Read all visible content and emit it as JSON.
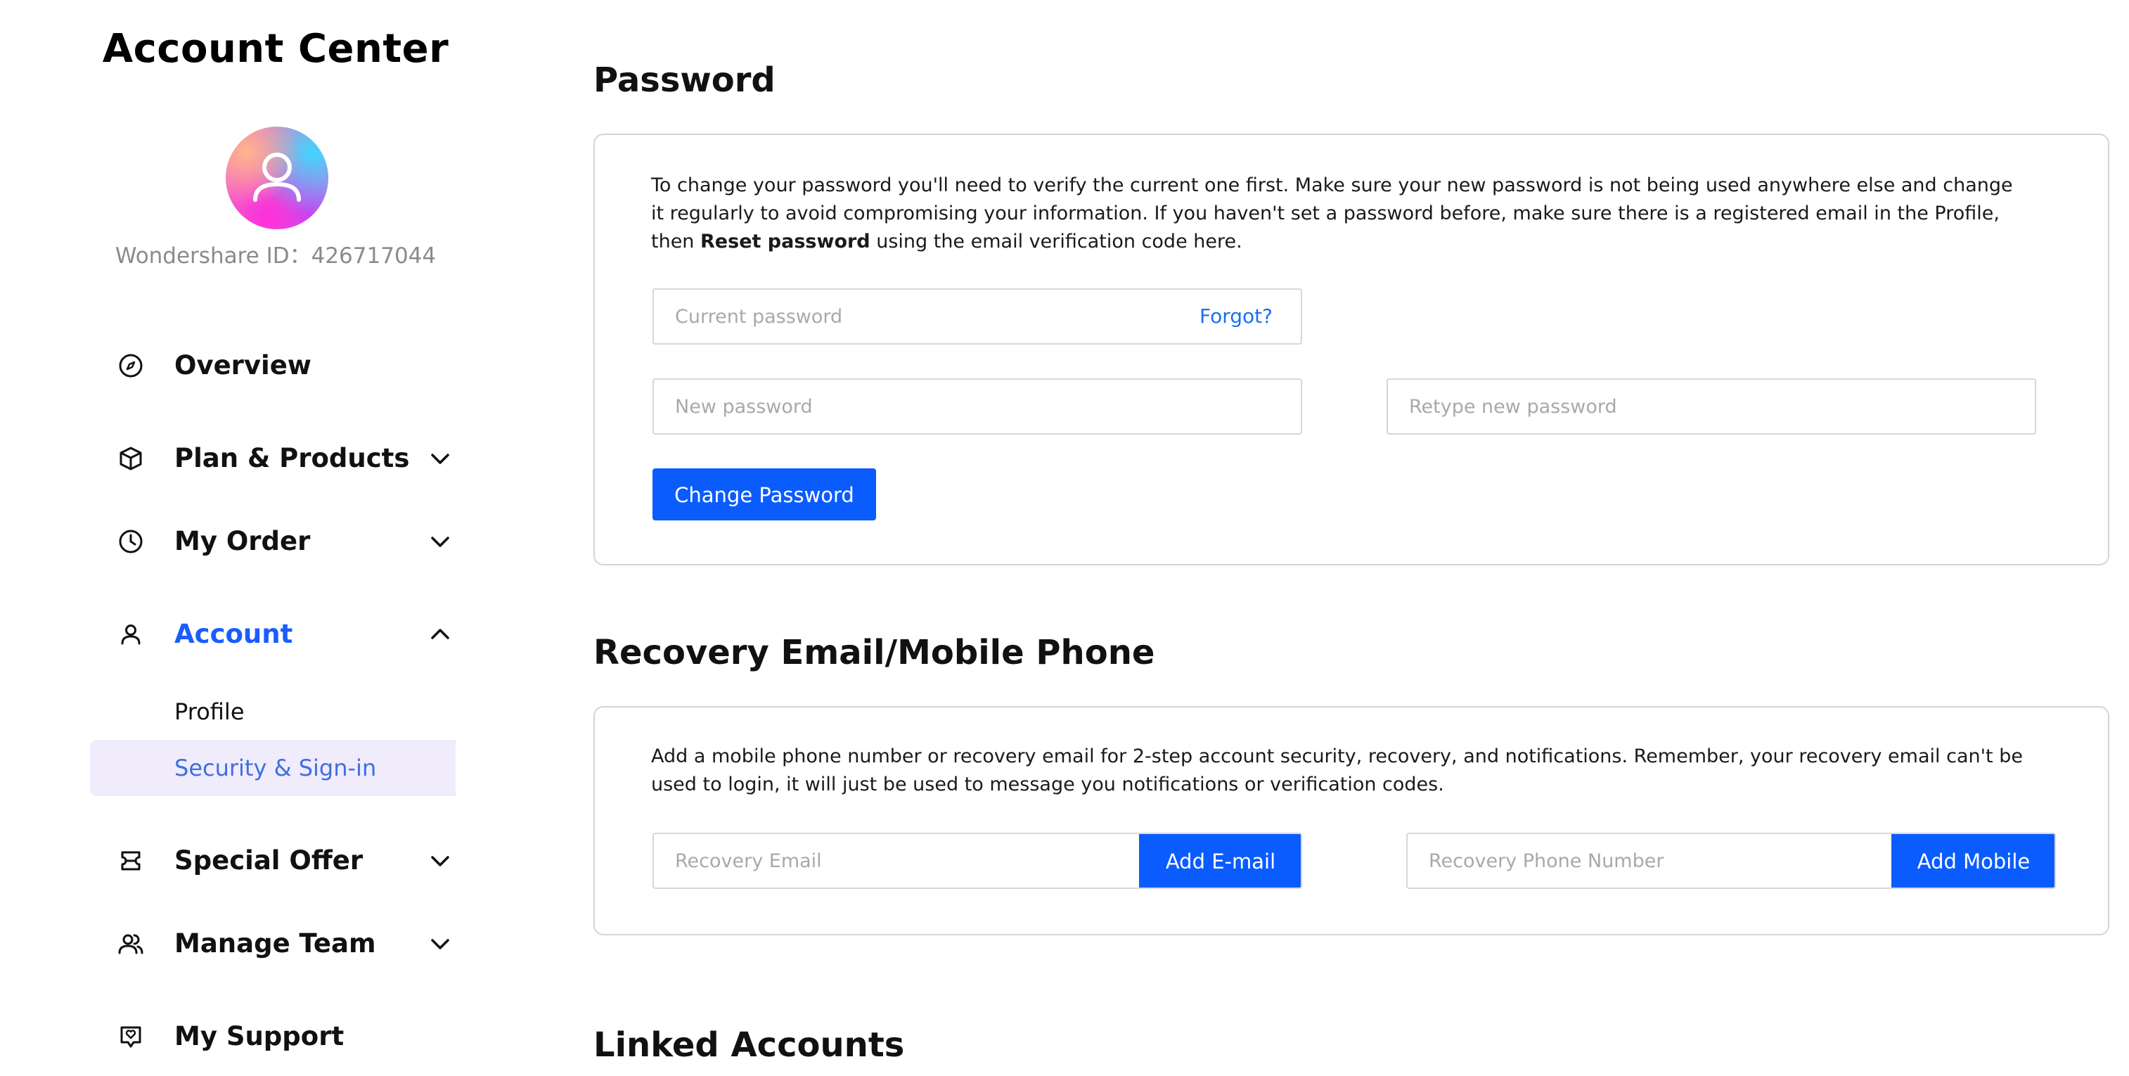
{
  "sidebar": {
    "title": "Account Center",
    "wondershare_id": "Wondershare ID：426717044",
    "nav": [
      {
        "label": "Overview",
        "icon": "compass-icon"
      },
      {
        "label": "Plan & Products",
        "icon": "box-icon"
      },
      {
        "label": "My Order",
        "icon": "clock-icon"
      },
      {
        "label": "Account",
        "icon": "user-icon",
        "active": true
      },
      {
        "label": "Special Offer",
        "icon": "ticket-icon"
      },
      {
        "label": "Manage Team",
        "icon": "team-icon"
      },
      {
        "label": "My Support",
        "icon": "support-icon"
      }
    ],
    "account_sub": [
      {
        "label": "Profile"
      },
      {
        "label": "Security & Sign-in",
        "selected": true
      }
    ]
  },
  "password": {
    "title": "Password",
    "desc_part1": "To change your password you'll need to verify the current one first. Make sure your new password is not being used anywhere else and change it regularly to avoid compromising your information. If you haven't set a password before, make sure there is a registered email in the Profile, then ",
    "desc_bold": "Reset password",
    "desc_part2": " using the email verification code here.",
    "current_placeholder": "Current password",
    "forgot_label": "Forgot?",
    "new_placeholder": "New password",
    "retype_placeholder": "Retype new password",
    "change_button": "Change Password"
  },
  "recovery": {
    "title": "Recovery Email/Mobile Phone",
    "desc": "Add a mobile phone number or recovery email for 2-step account security, recovery, and notifications. Remember, your recovery email can't be used to login, it will just be used to message you notifications or verification codes.",
    "email_placeholder": "Recovery Email",
    "add_email_button": "Add E-mail",
    "phone_placeholder": "Recovery Phone Number",
    "add_mobile_button": "Add Mobile"
  },
  "linked": {
    "title": "Linked Accounts"
  },
  "colors": {
    "accent": "#0a5cff",
    "active_nav": "#1a5cff",
    "selected_bg": "#f0ecfc",
    "link": "#1a6ff0"
  }
}
